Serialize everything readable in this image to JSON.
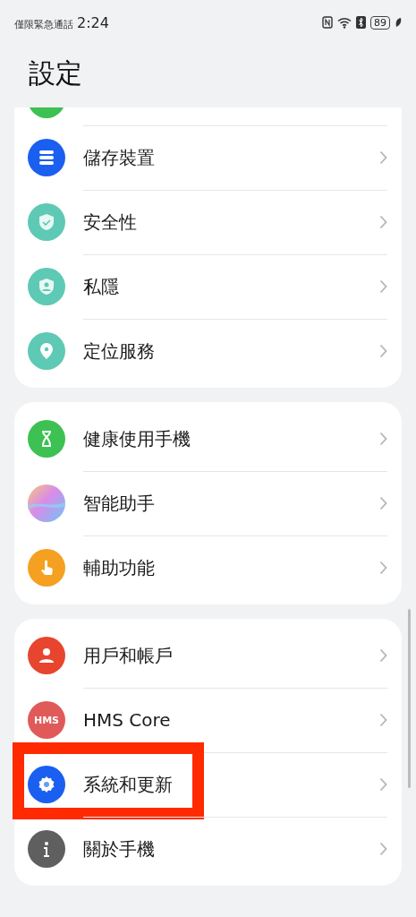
{
  "status_bar": {
    "notice": "僅限緊急通話",
    "time": "2:24",
    "battery": "89"
  },
  "title": "設定",
  "groups": [
    {
      "cut_top": true,
      "items": [
        {
          "label": "儲存裝置",
          "kind": "storage",
          "color": "#1a5ff0",
          "highlighted": false
        },
        {
          "label": "安全性",
          "kind": "security",
          "color": "#5ec9b4",
          "highlighted": false
        },
        {
          "label": "私隱",
          "kind": "privacy",
          "color": "#5ec9b4",
          "highlighted": false
        },
        {
          "label": "定位服務",
          "kind": "location",
          "color": "#5ec9b4",
          "highlighted": false
        }
      ]
    },
    {
      "items": [
        {
          "label": "健康使用手機",
          "kind": "hourglass",
          "color": "#3cc152",
          "highlighted": false
        },
        {
          "label": "智能助手",
          "kind": "assistant",
          "highlighted": false
        },
        {
          "label": "輔助功能",
          "kind": "hand",
          "color": "#f5a020",
          "highlighted": false
        }
      ]
    },
    {
      "items": [
        {
          "label": "用戶和帳戶",
          "kind": "user",
          "color": "#e8452e",
          "highlighted": false
        },
        {
          "label": "HMS Core",
          "kind": "text",
          "icon_text": "HMS",
          "color": "#e05a5a",
          "highlighted": false
        },
        {
          "label": "系統和更新",
          "kind": "gear",
          "color": "#1a5ff0",
          "highlighted": true
        },
        {
          "label": "關於手機",
          "kind": "info",
          "color": "#5f5f5f",
          "highlighted": false
        }
      ]
    }
  ]
}
